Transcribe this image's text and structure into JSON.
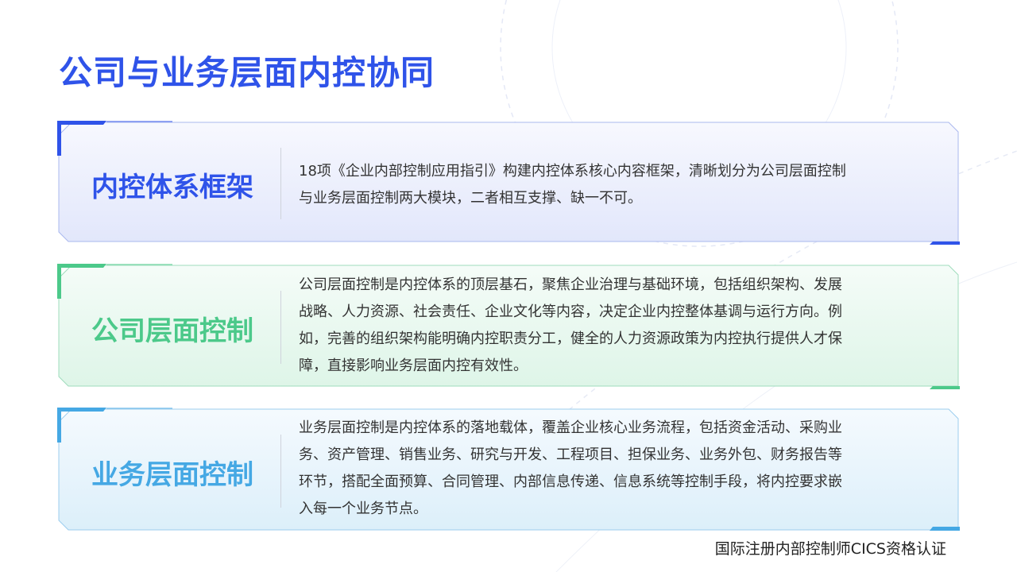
{
  "page": {
    "title": "公司与业务层面内控协同"
  },
  "cards": [
    {
      "heading": "内控体系框架",
      "lines": [
        "18项《企业内部控制应用指引》构建内控体系核心内容框架，清晰划分为公司层面控制",
        "与业务层面控制两大模块，二者相互支撑、缺一不可。"
      ],
      "accent": "#2f53e9"
    },
    {
      "heading": "公司层面控制",
      "lines": [
        "公司层面控制是内控体系的顶层基石，聚焦企业治理与基础环境，包括组织架构、发展",
        "战略、人力资源、社会责任、企业文化等内容，决定企业内控整体基调与运行方向。例",
        "如，完善的组织架构能明确内控职责分工，健全的人力资源政策为内控执行提供人才保",
        "障，直接影响业务层面内控有效性。"
      ],
      "accent": "#4cc98a"
    },
    {
      "heading": "业务层面控制",
      "lines": [
        "业务层面控制是内控体系的落地载体，覆盖企业核心业务流程，包括资金活动、采购业",
        "务、资产管理、销售业务、研究与开发、工程项目、担保业务、业务外包、财务报告等",
        "环节，搭配全面预算、合同管理、内部信息传递、信息系统等控制手段，将内控要求嵌",
        "入每一个业务节点。"
      ],
      "accent": "#45a8e4"
    }
  ],
  "footer": {
    "text": "国际注册内部控制师CICS资格认证"
  }
}
